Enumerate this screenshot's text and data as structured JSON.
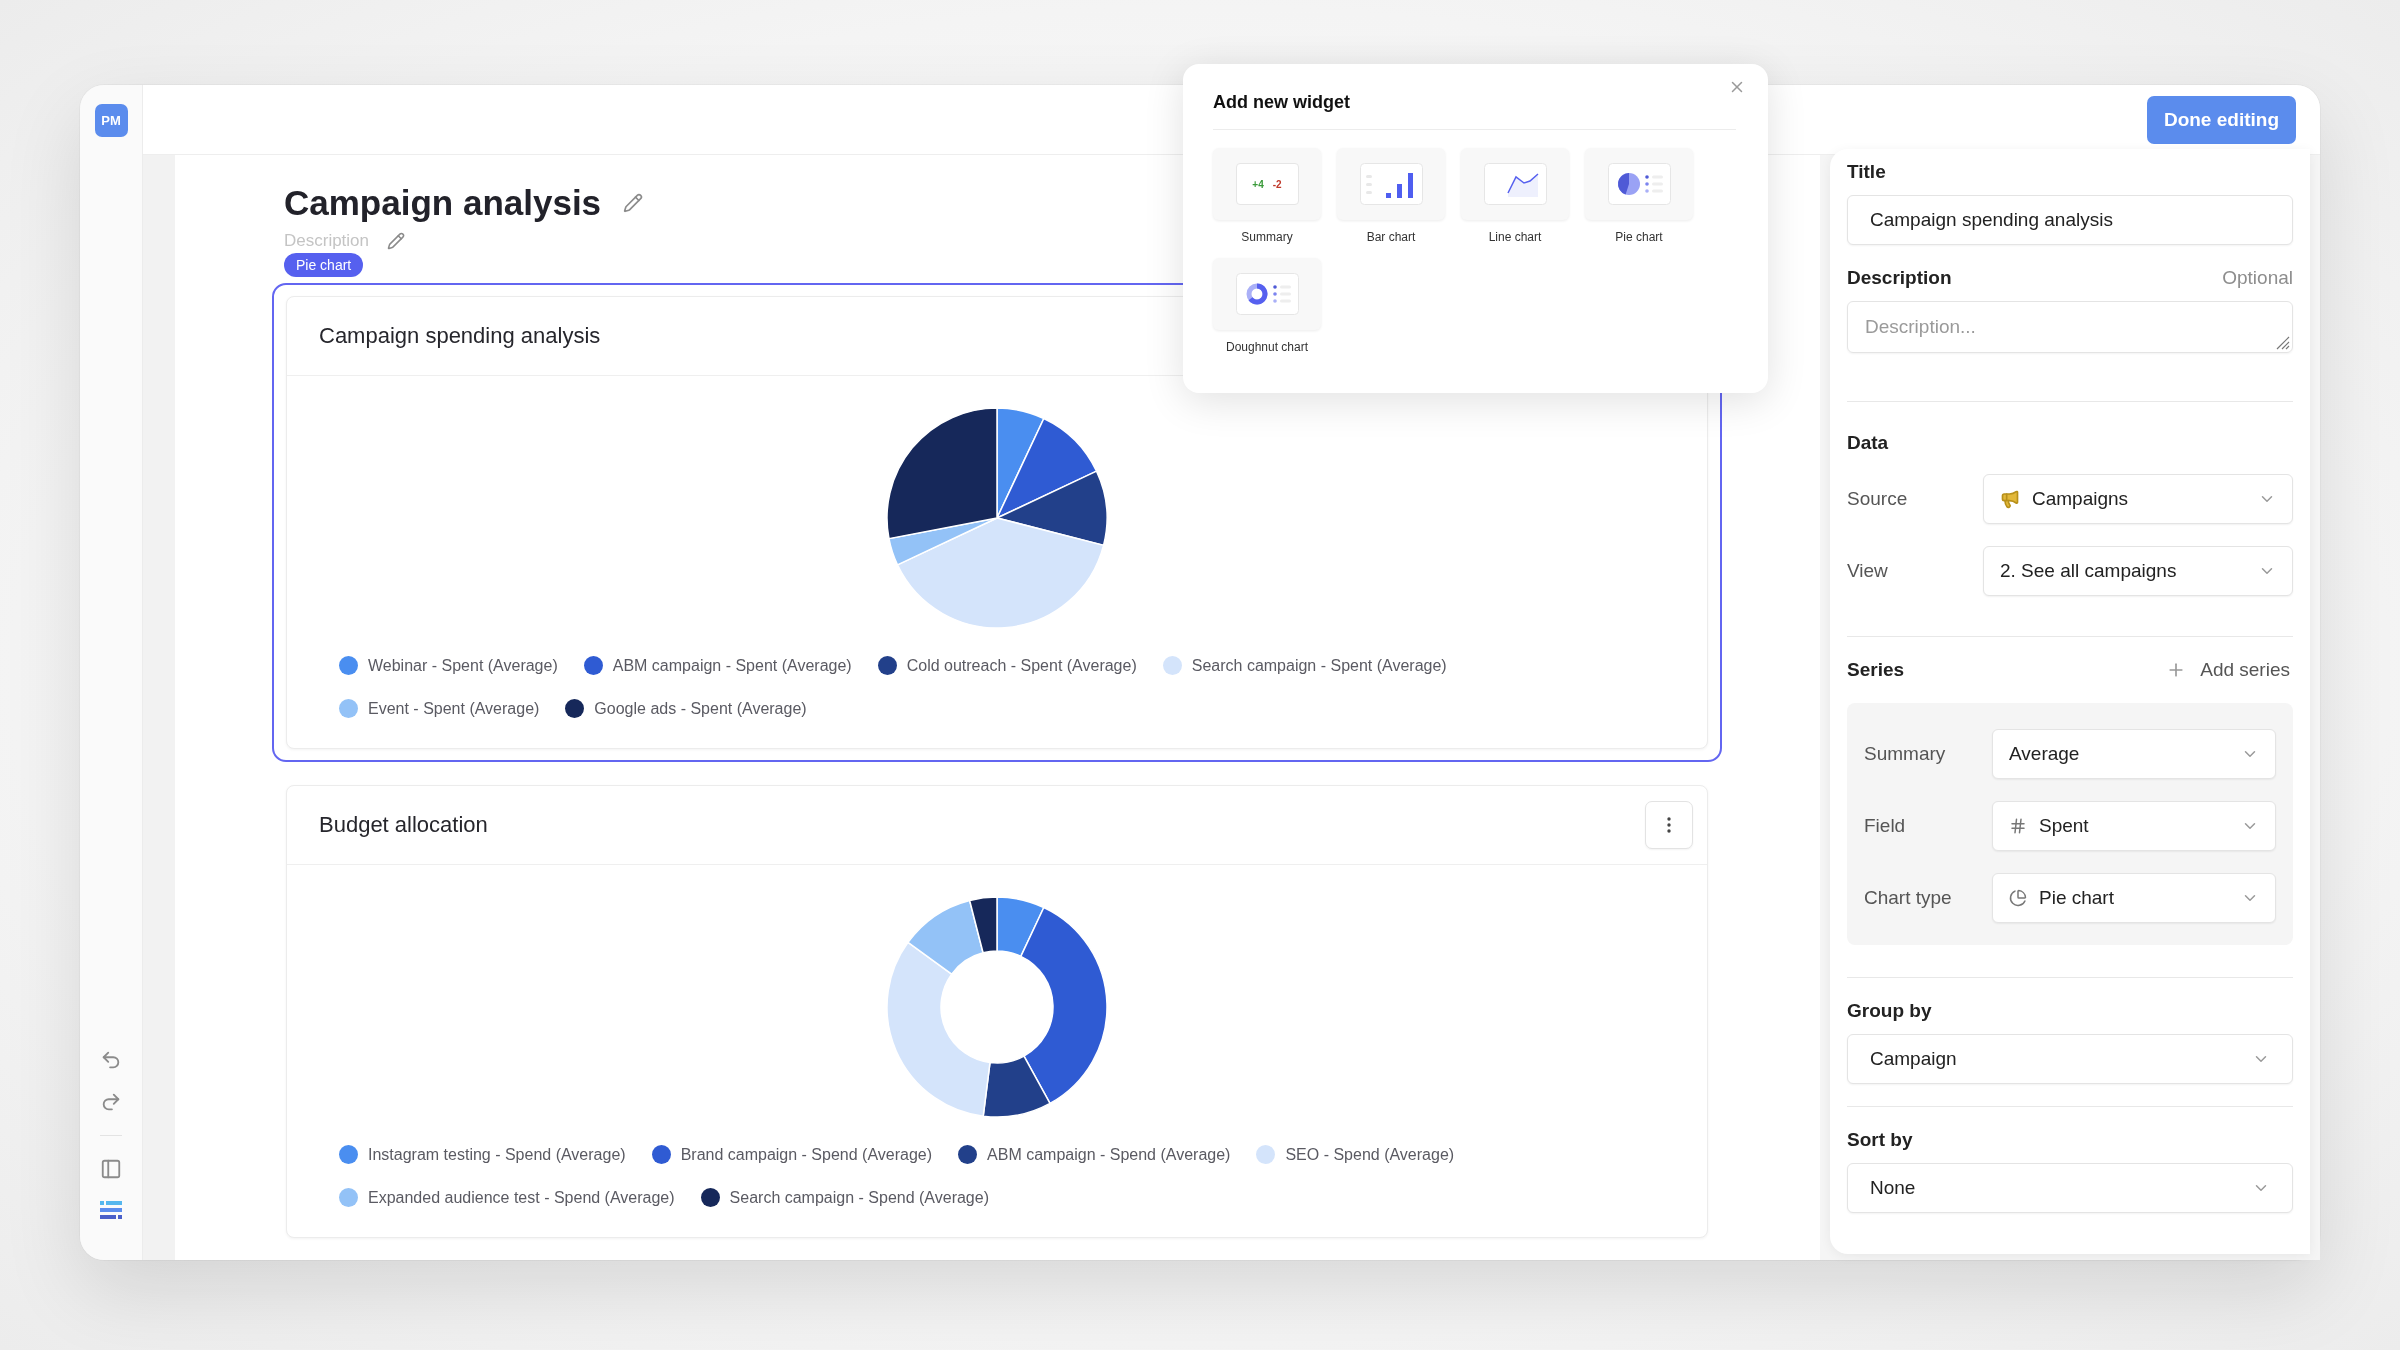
{
  "app": {
    "logo": "PM"
  },
  "header": {
    "done_button": "Done editing"
  },
  "page": {
    "title": "Campaign analysis",
    "description_placeholder": "Description",
    "badge": "Pie chart"
  },
  "widgets": [
    {
      "title": "Campaign spending analysis",
      "kind": "pie",
      "selected": true,
      "legend": [
        {
          "label": "Webinar - Spent (Average)",
          "color": "#4a8ef0"
        },
        {
          "label": "ABM campaign - Spent (Average)",
          "color": "#2f5bd3"
        },
        {
          "label": "Cold outreach - Spent (Average)",
          "color": "#22408a"
        },
        {
          "label": "Search campaign - Spent (Average)",
          "color": "#d4e4fb"
        },
        {
          "label": "Event - Spent (Average)",
          "color": "#93c2f7"
        },
        {
          "label": "Google ads - Spent (Average)",
          "color": "#16285a"
        }
      ]
    },
    {
      "title": "Budget allocation",
      "kind": "doughnut",
      "selected": false,
      "legend": [
        {
          "label": "Instagram testing - Spend (Average)",
          "color": "#4a8ef0"
        },
        {
          "label": "Brand campaign - Spend (Average)",
          "color": "#2f5bd3"
        },
        {
          "label": "ABM campaign - Spend (Average)",
          "color": "#22408a"
        },
        {
          "label": "SEO - Spend (Average)",
          "color": "#d4e4fb"
        },
        {
          "label": "Expanded audience test - Spend (Average)",
          "color": "#93c2f7"
        },
        {
          "label": "Search campaign - Spend (Average)",
          "color": "#16285a"
        }
      ]
    }
  ],
  "popup": {
    "title": "Add new widget",
    "options": [
      {
        "kind": "summary",
        "label": "Summary",
        "preview": [
          "+4",
          "-2"
        ]
      },
      {
        "kind": "bar",
        "label": "Bar chart"
      },
      {
        "kind": "line",
        "label": "Line chart"
      },
      {
        "kind": "pie",
        "label": "Pie chart"
      },
      {
        "kind": "doughnut",
        "label": "Doughnut chart"
      }
    ]
  },
  "panel": {
    "title_label": "Title",
    "title_value": "Campaign spending analysis",
    "description_label": "Description",
    "description_optional": "Optional",
    "description_placeholder": "Description...",
    "data": {
      "heading": "Data",
      "rows": [
        {
          "label": "Source",
          "value": "Campaigns"
        },
        {
          "label": "View",
          "value": "2. See all campaigns"
        }
      ]
    },
    "series": {
      "heading": "Series",
      "add": "Add series",
      "rows": [
        {
          "label": "Summary",
          "value": "Average"
        },
        {
          "label": "Field",
          "value": "Spent"
        },
        {
          "label": "Chart type",
          "value": "Pie chart"
        }
      ]
    },
    "group_by": {
      "label": "Group by",
      "value": "Campaign"
    },
    "sort_by": {
      "label": "Sort by",
      "value": "None"
    }
  }
}
